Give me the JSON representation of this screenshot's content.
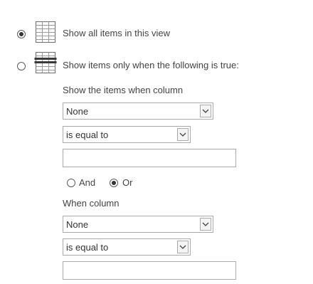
{
  "filter": {
    "option_all": {
      "label": "Show all items in this view",
      "selected": true,
      "icon": "list-view-icon"
    },
    "option_conditional": {
      "label": "Show items only when the following is true:",
      "selected": false,
      "icon": "filtered-list-icon"
    },
    "condition1": {
      "heading": "Show the items when column",
      "column_value": "None",
      "operator_value": "is equal to",
      "value_text": ""
    },
    "logic": {
      "and_label": "And",
      "or_label": "Or",
      "selected": "Or"
    },
    "condition2": {
      "heading": "When column",
      "column_value": "None",
      "operator_value": "is equal to",
      "value_text": ""
    }
  }
}
